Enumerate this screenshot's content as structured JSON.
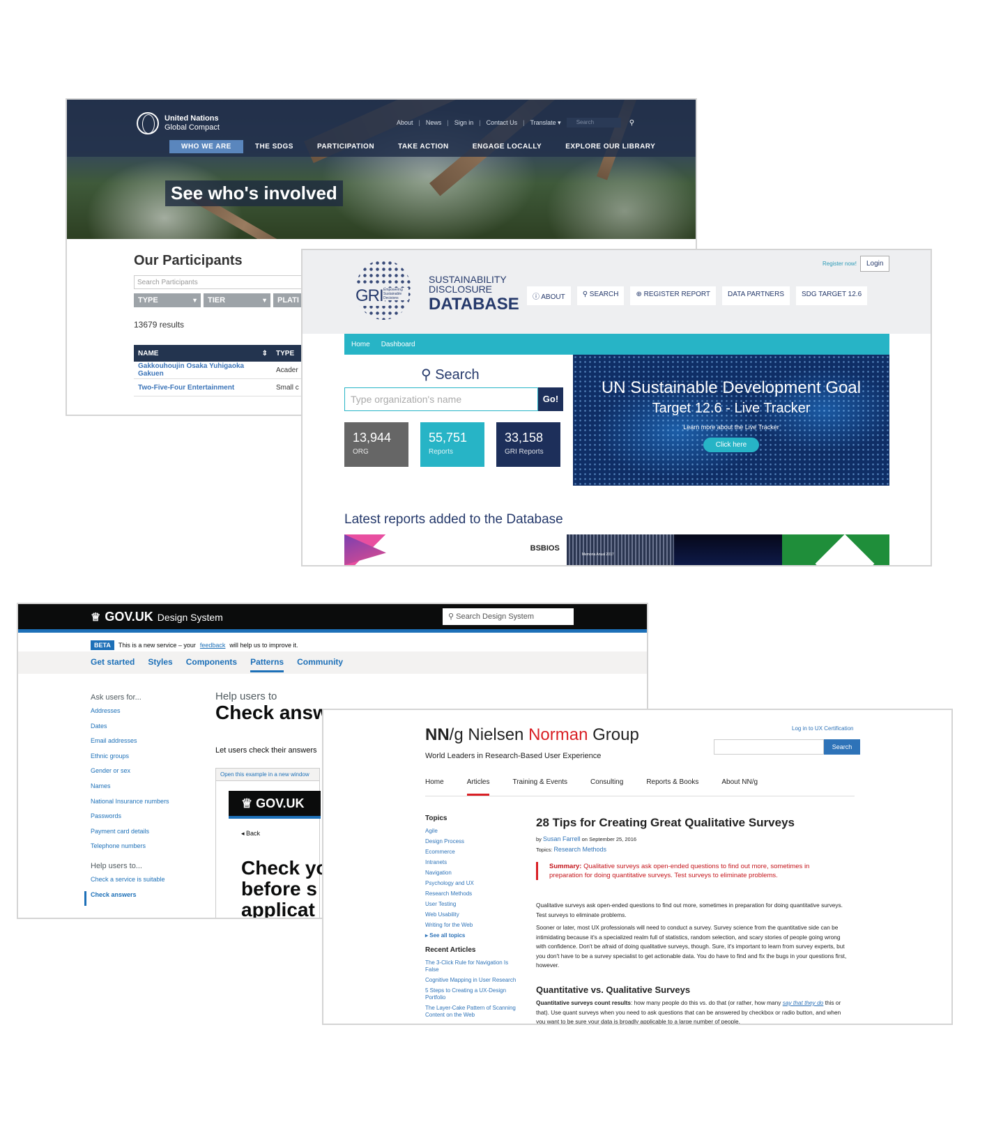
{
  "ungc": {
    "logo_line1": "United Nations",
    "logo_line2": "Global Compact",
    "utility_links": [
      "About",
      "News",
      "Sign in",
      "Contact Us",
      "Translate ▾"
    ],
    "search_placeholder": "Search",
    "nav": [
      "WHO WE ARE",
      "THE SDGS",
      "PARTICIPATION",
      "TAKE ACTION",
      "ENGAGE LOCALLY",
      "EXPLORE OUR LIBRARY"
    ],
    "banner": "See who's involved",
    "heading": "Our Participants",
    "participant_search_placeholder": "Search Participants",
    "filters": [
      "TYPE",
      "TIER",
      "PLATI"
    ],
    "results": "13679 results",
    "table_headers": [
      "NAME",
      "TYPE"
    ],
    "rows": [
      {
        "name": "Gakkouhoujin Osaka Yuhigaoka Gakuen",
        "type": "Acader"
      },
      {
        "name": "Two-Five-Four Entertainment",
        "type": "Small c"
      }
    ]
  },
  "gri": {
    "logo_text": "GRI",
    "logo_tag": "Empowering Sustainable Decisions",
    "title_line1": "SUSTAINABILITY",
    "title_line2": "DISCLOSURE",
    "title_line3": "DATABASE",
    "register_now": "Register now!",
    "login": "Login",
    "nav": [
      "ABOUT",
      "SEARCH",
      "REGISTER REPORT",
      "DATA PARTNERS",
      "SDG TARGET 12.6"
    ],
    "breadcrumbs": [
      "Home",
      "Dashboard"
    ],
    "search_title": "Search",
    "search_placeholder": "Type organization's name",
    "go": "Go!",
    "stats": [
      {
        "number": "13,944",
        "label": "ORG",
        "color": "#666666"
      },
      {
        "number": "55,751",
        "label": "Reports",
        "color": "#27b4c6"
      },
      {
        "number": "33,158",
        "label": "GRI Reports",
        "color": "#1d2f5a"
      }
    ],
    "sdg_title1": "UN Sustainable Development Goal",
    "sdg_title2": "Target 12.6 - Live Tracker",
    "sdg_sub": "Learn more about the Live Tracker",
    "sdg_button": "Click here",
    "latest_heading": "Latest reports added to the Database",
    "thumbnails": [
      "",
      "BSBIOS",
      "Memoria Anual 2017",
      "",
      ""
    ]
  },
  "gov": {
    "brand": "GOV.UK",
    "brand_sub": "Design System",
    "search_placeholder": "Search Design System",
    "beta_tag": "BETA",
    "beta_text_before": "This is a new service – your",
    "beta_link": "feedback",
    "beta_text_after": "will help us to improve it.",
    "tabs": [
      "Get started",
      "Styles",
      "Components",
      "Patterns",
      "Community"
    ],
    "ask_heading": "Ask users for...",
    "ask_items": [
      "Addresses",
      "Dates",
      "Email addresses",
      "Ethnic groups",
      "Gender or sex",
      "Names",
      "National Insurance numbers",
      "Passwords",
      "Payment card details",
      "Telephone numbers"
    ],
    "help_heading": "Help users to...",
    "help_items": [
      "Check a service is suitable",
      "Check answers"
    ],
    "caption": "Help users to",
    "page_title": "Check answers",
    "lede": "Let users check their answers",
    "open_example": "Open this example in a new window",
    "mini_brand": "GOV.UK",
    "back": "Back",
    "big_lines": [
      "Check yo",
      "before s",
      "applicat"
    ]
  },
  "nng": {
    "logo_nn": "NN",
    "logo_g": "/g",
    "brand_nielsen": "Nielsen",
    "brand_norman": "Norman",
    "brand_group": "Group",
    "tagline": "World Leaders in Research-Based User Experience",
    "login_link": "Log in to UX Certification",
    "search_button": "Search",
    "nav": [
      "Home",
      "Articles",
      "Training & Events",
      "Consulting",
      "Reports & Books",
      "About NN/g"
    ],
    "topics_heading": "Topics",
    "topics": [
      "Agile",
      "Design Process",
      "Ecommerce",
      "Intranets",
      "Navigation",
      "Psychology and UX",
      "Research Methods",
      "User Testing",
      "Web Usability",
      "Writing for the Web"
    ],
    "see_all": "▸ See all topics",
    "recent_heading": "Recent Articles",
    "recent": [
      "The 3-Click Rule for Navigation Is False",
      "Cognitive Mapping in User Research",
      "5 Steps to Creating a UX-Design Portfolio",
      "The Layer-Cake Pattern of Scanning Content on the Web"
    ],
    "article_title": "28 Tips for Creating Great Qualitative Surveys",
    "by": "by",
    "author": "Susan Farrell",
    "date": "on September 25, 2016",
    "topics_label": "Topics:",
    "topic_link": "Research Methods",
    "summary_label": "Summary:",
    "summary": "Qualitative surveys ask open-ended questions to find out more, sometimes in preparation for doing quantitative surveys. Test surveys to eliminate problems.",
    "para1": "Qualitative surveys ask open-ended questions to find out more, sometimes in preparation for doing quantitative surveys. Test surveys to eliminate problems.",
    "para2": "Sooner or later, most UX professionals will need to conduct a survey. Survey science from the quantitative side can be intimidating because it's a specialized realm full of statistics, random selection, and scary stories of people going wrong with confidence. Don't be afraid of doing qualitative surveys, though. Sure, it's important to learn from survey experts, but you don't have to be a survey specialist to get actionable data. You do have to find and fix the bugs in your questions first, however.",
    "subheading": "Quantitative vs. Qualitative Surveys",
    "para3_bold": "Quantitative surveys count results",
    "para3_a": ": how many people do this vs. do that (or rather, how many",
    "para3_link": "say that they do",
    "para3_b": "this or that). Use quant surveys when you need to ask questions that can be answered by checkbox or radio button, and when you want to be sure your data is broadly applicable to a large number of people."
  }
}
